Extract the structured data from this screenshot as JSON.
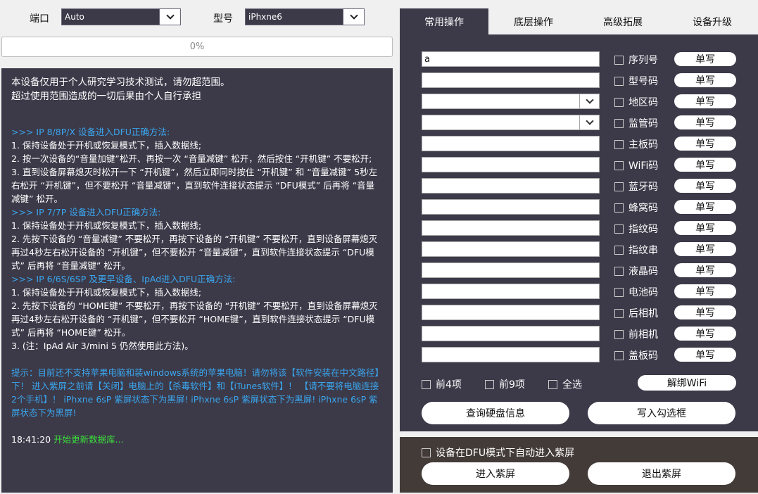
{
  "topbar": {
    "port_label": "端口",
    "port_value": "Auto",
    "model_label": "型号",
    "model_value": "iPhxne6"
  },
  "progress": {
    "text": "0%",
    "value": 0
  },
  "log": {
    "notice1": "本设备仅用于个人研究学习技术测试，请勿超范围。",
    "notice2": "超过使用范围造成的一切后果由个人自行承担",
    "h1": ">>> IP 8/8P/X 设备进入DFU正确方法:",
    "s1": [
      "1. 保持设备处于开机或恢复模式下，插入数据线;",
      "2. 按一次设备的“音量加键”松开、再按一次 “音量减键” 松开，然后按住 “开机键” 不要松开;",
      "3. 直到设备屏幕熄灭时松开一下 “开机键”，然后立即同时按住 “开机键” 和 “音量减键” 5秒左右松开 “开机键”，但不要松开 “音量减键”，直到软件连接状态提示 “DFU模式” 后再将 “音量减键” 松开。"
    ],
    "h2": ">>> IP 7/7P 设备进入DFU正确方法:",
    "s2": [
      "1. 保持设备处于开机或恢复模式下，插入数据线;",
      "2. 先按下设备的 “音量减键” 不要松开，再按下设备的 “开机键” 不要松开，直到设备屏幕熄灭再过4秒左右松开设备的 “开机键”，但不要松开 “音量减键”，直到软件连接状态提示 “DFU模式” 后再将 “音量减键” 松开。"
    ],
    "h3": ">>> IP 6/6S/6SP 及更早设备、IpAd进入DFU正确方法:",
    "s3": [
      "1. 保持设备处于开机或恢复模式下，插入数据线;",
      "2. 先按下设备的 “HOME键” 不要松开，再按下设备的 “开机键” 不要松开，直到设备屏幕熄灭再过4秒左右松开设备的 “开机键”，但不要松开 “HOME键”，直到软件连接状态提示 “DFU模式” 后再将 “HOME键” 松开。",
      "3. (注：IpAd Air 3/mini 5 仍然使用此方法)。"
    ],
    "tip": "提示：目前还不支持苹果电脑和装windows系统的苹果电脑！请勿将该【软件安装在中文路径】下！ 进入紫屏之前请【关闭】电脑上的【杀毒软件】和【iTunes软件】！ 【请不要将电脑连接2个手机】！ iPhxne 6sP 紫屏状态下为黑屏! iPhxne 6sP 紫屏状态下为黑屏! iPhxne 6sP 紫屏状态下为黑屏!",
    "time": "18:41:20",
    "status": "开始更新数据库..."
  },
  "tabs": [
    "常用操作",
    "底层操作",
    "高级拓展",
    "设备升级"
  ],
  "fields": [
    {
      "value": "a",
      "label": "序列号",
      "dropdown": false
    },
    {
      "value": "",
      "label": "型号码",
      "dropdown": false
    },
    {
      "value": "",
      "label": "地区码",
      "dropdown": true
    },
    {
      "value": "",
      "label": "监管码",
      "dropdown": true
    },
    {
      "value": "",
      "label": "主板码",
      "dropdown": false
    },
    {
      "value": "",
      "label": "WiFi码",
      "dropdown": false
    },
    {
      "value": "",
      "label": "蓝牙码",
      "dropdown": false
    },
    {
      "value": "",
      "label": "蜂窝码",
      "dropdown": false
    },
    {
      "value": "",
      "label": "指纹码",
      "dropdown": false
    },
    {
      "value": "",
      "label": "指纹串",
      "dropdown": false
    },
    {
      "value": "",
      "label": "液晶码",
      "dropdown": false
    },
    {
      "value": "",
      "label": "电池码",
      "dropdown": false
    },
    {
      "value": "",
      "label": "后相机",
      "dropdown": false
    },
    {
      "value": "",
      "label": "前相机",
      "dropdown": false
    },
    {
      "value": "",
      "label": "盖板码",
      "dropdown": false
    }
  ],
  "write_label": "单写",
  "options": {
    "first4": "前4项",
    "first9": "前9项",
    "all": "全选",
    "unbind_wifi": "解绑WiFi"
  },
  "actions": {
    "query_disk": "查询硬盘信息",
    "write_checked": "写入勾选框"
  },
  "purple": {
    "auto_label": "设备在DFU模式下自动进入紫屏",
    "enter": "进入紫屏",
    "exit": "退出紫屏"
  }
}
